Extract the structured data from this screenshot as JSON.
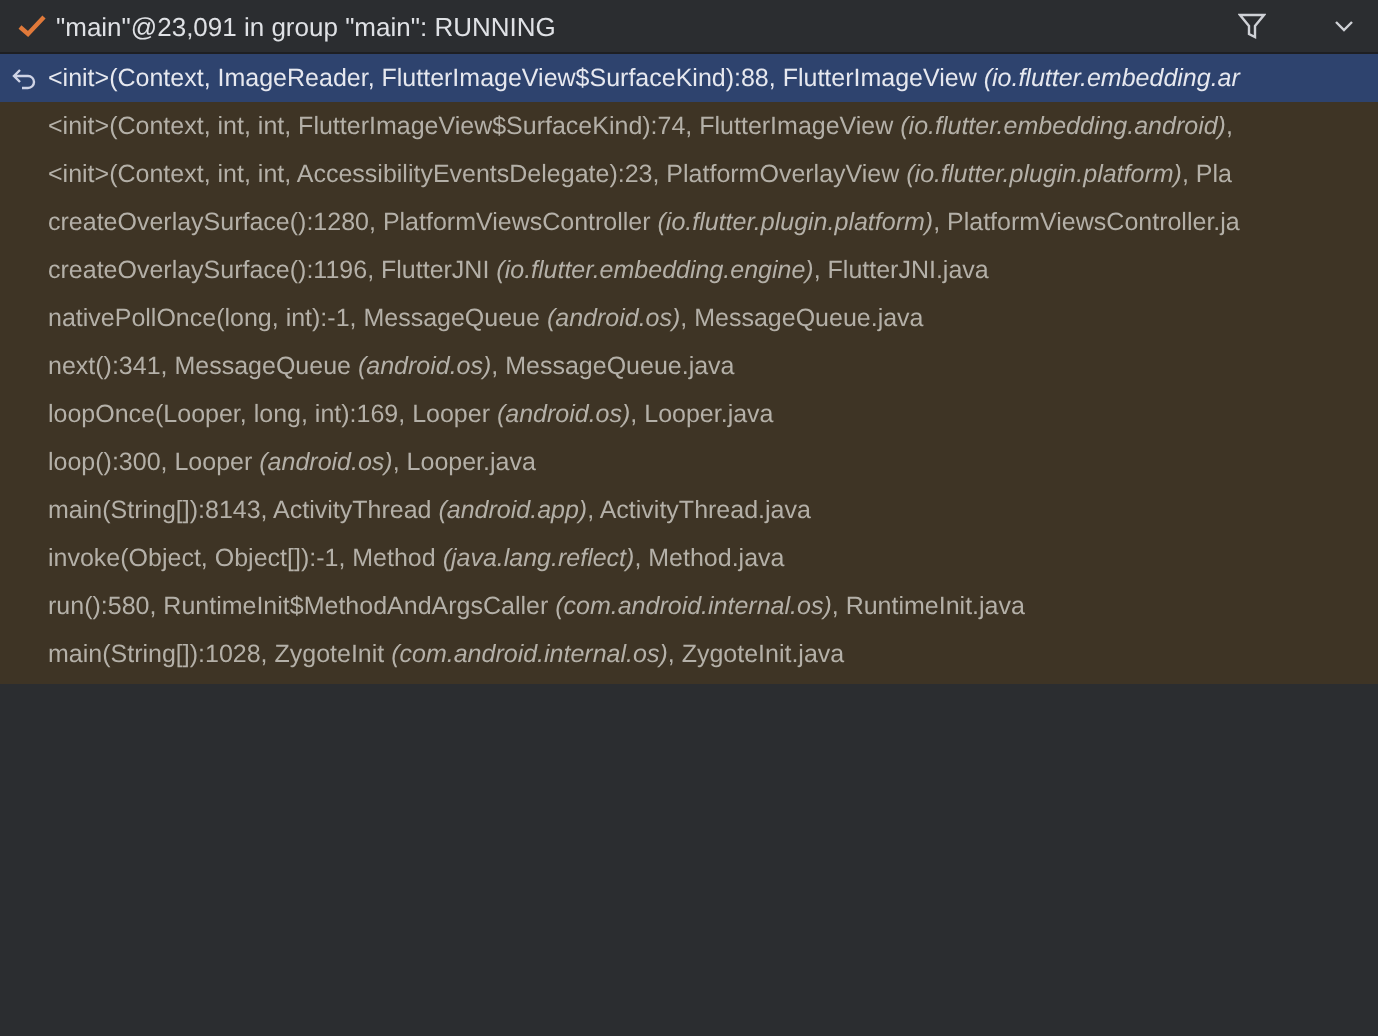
{
  "thread": {
    "title": "\"main\"@23,091 in group \"main\": RUNNING"
  },
  "frames": [
    {
      "call": "<init>(Context, ImageReader, FlutterImageView$SurfaceKind):88, FlutterImageView",
      "package": "(io.flutter.embedding.ar",
      "selected": true
    },
    {
      "call": "<init>(Context, int, int, FlutterImageView$SurfaceKind):74, FlutterImageView",
      "package": "(io.flutter.embedding.android)",
      "tail": ",",
      "selected": false
    },
    {
      "call": "<init>(Context, int, int, AccessibilityEventsDelegate):23, PlatformOverlayView",
      "package": "(io.flutter.plugin.platform)",
      "tail": ", Pla",
      "selected": false
    },
    {
      "call": "createOverlaySurface():1280, PlatformViewsController",
      "package": "(io.flutter.plugin.platform)",
      "tail": ", PlatformViewsController.ja",
      "selected": false
    },
    {
      "call": "createOverlaySurface():1196, FlutterJNI",
      "package": "(io.flutter.embedding.engine)",
      "tail": ", FlutterJNI.java",
      "selected": false
    },
    {
      "call": "nativePollOnce(long, int):-1, MessageQueue",
      "package": "(android.os)",
      "tail": ", MessageQueue.java",
      "selected": false
    },
    {
      "call": "next():341, MessageQueue",
      "package": "(android.os)",
      "tail": ", MessageQueue.java",
      "selected": false
    },
    {
      "call": "loopOnce(Looper, long, int):169, Looper",
      "package": "(android.os)",
      "tail": ", Looper.java",
      "selected": false
    },
    {
      "call": "loop():300, Looper",
      "package": "(android.os)",
      "tail": ", Looper.java",
      "selected": false
    },
    {
      "call": "main(String[]):8143, ActivityThread",
      "package": "(android.app)",
      "tail": ", ActivityThread.java",
      "selected": false
    },
    {
      "call": "invoke(Object, Object[]):-1, Method",
      "package": "(java.lang.reflect)",
      "tail": ", Method.java",
      "selected": false
    },
    {
      "call": "run():580, RuntimeInit$MethodAndArgsCaller",
      "package": "(com.android.internal.os)",
      "tail": ", RuntimeInit.java",
      "selected": false
    },
    {
      "call": "main(String[]):1028, ZygoteInit",
      "package": "(com.android.internal.os)",
      "tail": ", ZygoteInit.java",
      "selected": false
    }
  ]
}
